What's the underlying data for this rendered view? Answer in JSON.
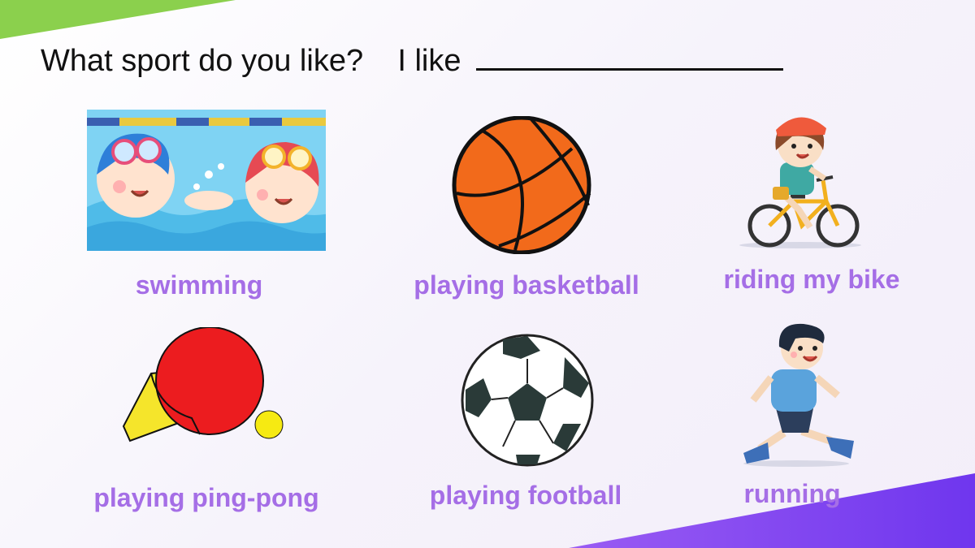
{
  "question": {
    "prompt": "What sport do you like?",
    "answer_start": "I like"
  },
  "sports": [
    {
      "label": "swimming",
      "icon": "swimming-children-icon"
    },
    {
      "label": "playing basketball",
      "icon": "basketball-icon"
    },
    {
      "label": "riding my bike",
      "icon": "girl-riding-bike-icon"
    },
    {
      "label": "playing ping-pong",
      "icon": "ping-pong-paddle-icon"
    },
    {
      "label": "playing football",
      "icon": "soccer-ball-icon"
    },
    {
      "label": "running",
      "icon": "running-boy-icon"
    }
  ],
  "colors": {
    "label": "#a56ee6",
    "accent_green": "#8bd04d",
    "accent_purple": "#7b3ff0"
  }
}
